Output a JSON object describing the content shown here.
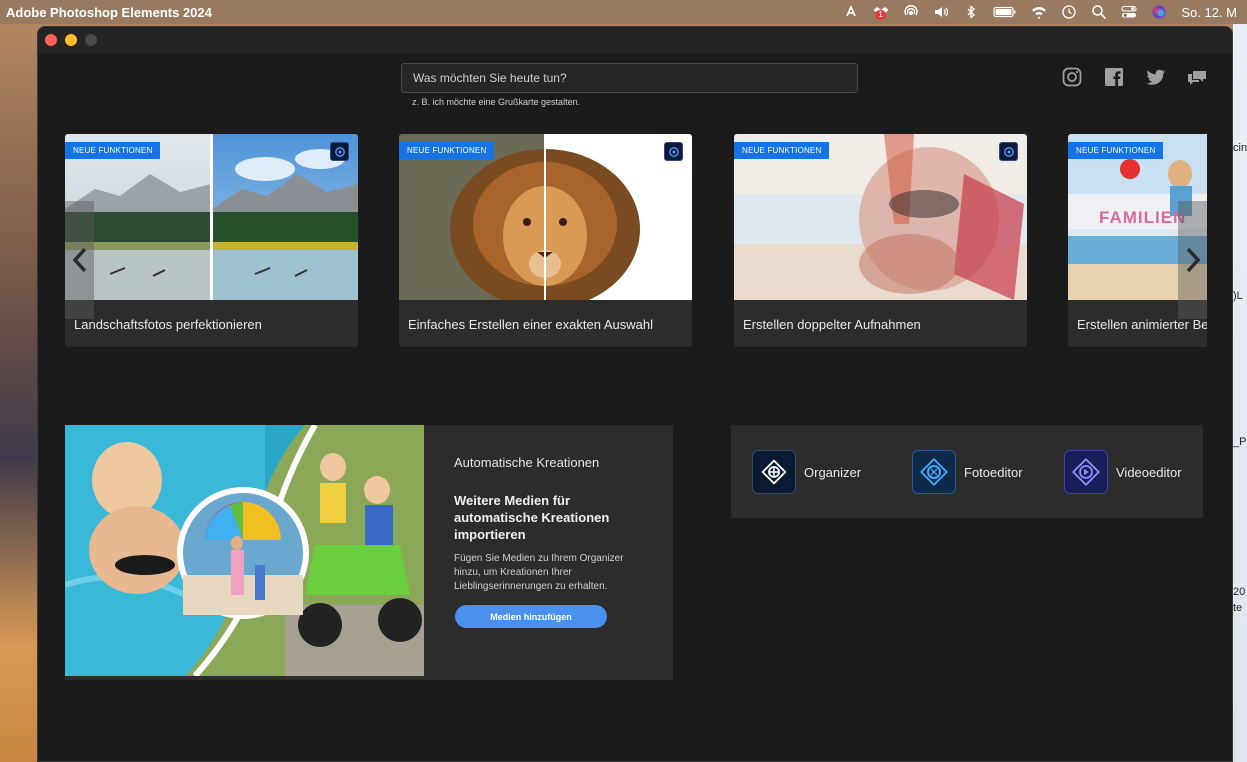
{
  "menubar": {
    "app_name": "Adobe Photoshop Elements 2024",
    "notification_badge": "1",
    "clock": "So. 12. M"
  },
  "search": {
    "placeholder": "Was möchten Sie heute tun?",
    "hint": "z. B. ich möchte eine Grußkarte gestalten."
  },
  "social": [
    "instagram-icon",
    "facebook-icon",
    "twitter-icon",
    "feedback-icon"
  ],
  "cards": [
    {
      "badge": "NEUE FUNKTIONEN",
      "title": "Landschaftsfotos perfektionieren"
    },
    {
      "badge": "NEUE FUNKTIONEN",
      "title": "Einfaches Erstellen einer exakten Auswahl"
    },
    {
      "badge": "NEUE FUNKTIONEN",
      "title": "Erstellen doppelter Aufnahmen"
    },
    {
      "badge": "NEUE FUNKTIONEN",
      "title": "Erstellen animierter Be",
      "overlay_text": "FAMILIEN"
    }
  ],
  "auto": {
    "heading": "Automatische Kreationen",
    "subhead": "Weitere Medien für automatische Kreationen importieren",
    "description": "Fügen Sie Medien zu Ihrem Organizer hinzu, um Kreationen Ihrer Lieblingserinnerungen zu erhalten.",
    "button": "Medien hinzufügen"
  },
  "launcher": [
    {
      "label": "Organizer",
      "color": "#0b1a33"
    },
    {
      "label": "Fotoeditor",
      "color": "#0d2a4a"
    },
    {
      "label": "Videoeditor",
      "color": "#1a1f5a"
    }
  ],
  "desktop_peek": [
    "cin",
    ")L",
    "_P",
    "20",
    "te"
  ]
}
